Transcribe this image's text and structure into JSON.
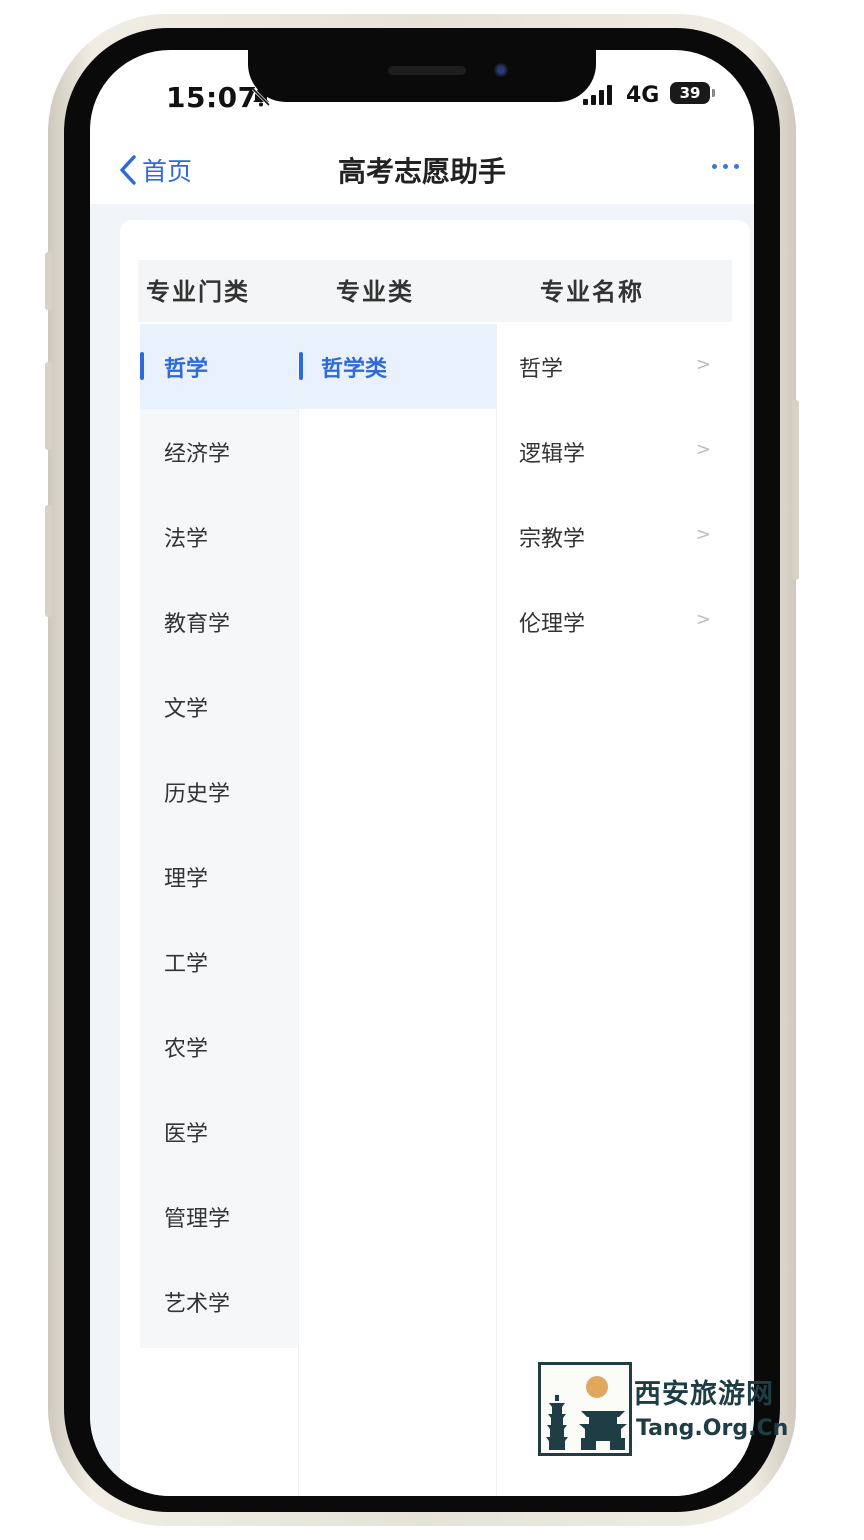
{
  "status": {
    "time": "15:07",
    "network": "4G",
    "battery": "39"
  },
  "nav": {
    "back_label": "首页",
    "title": "高考志愿助手"
  },
  "columns": {
    "category": "专业门类",
    "class": "专业类",
    "major": "专业名称"
  },
  "categories": [
    "哲学",
    "经济学",
    "法学",
    "教育学",
    "文学",
    "历史学",
    "理学",
    "工学",
    "农学",
    "医学",
    "管理学",
    "艺术学"
  ],
  "classes": [
    "哲学类"
  ],
  "majors": [
    "哲学",
    "逻辑学",
    "宗教学",
    "伦理学"
  ],
  "row_chevron": ">",
  "watermark": {
    "name": "西安旅游网",
    "domain": "Tang.Org.Cn"
  },
  "colors": {
    "accent": "#2f6bd8",
    "selected_bg": "#e9f1fc",
    "logo": "#1f3d44",
    "sun": "#e0a760"
  }
}
